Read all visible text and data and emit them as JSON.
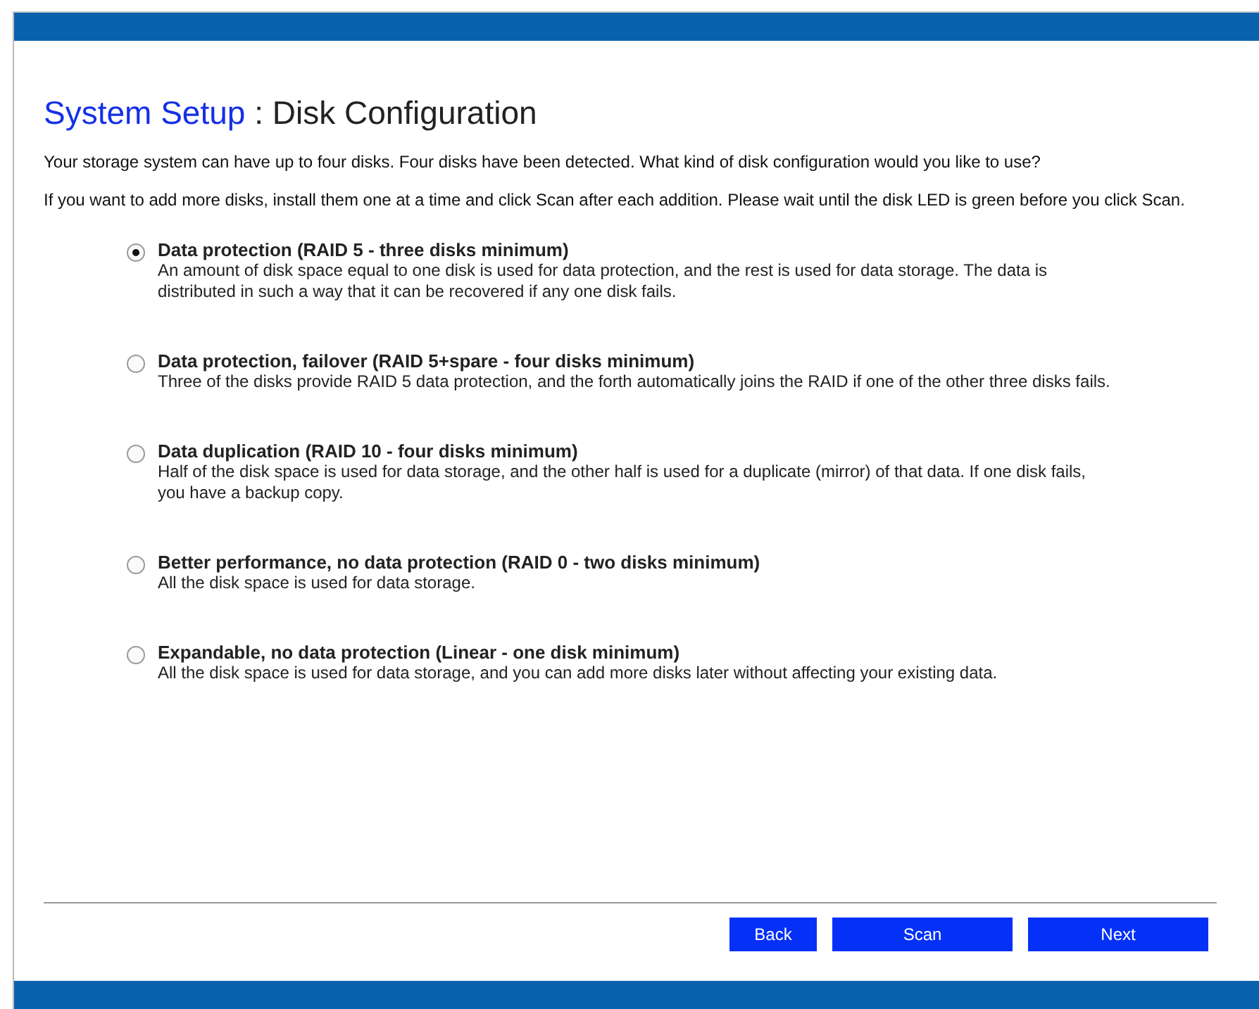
{
  "title": {
    "section": "System Setup",
    "separator": " : ",
    "page": "Disk Configuration"
  },
  "intro": [
    "Your storage system can have up to four disks. Four disks have been detected. What kind of disk configuration would you like to use?",
    "If you want to add more disks, install them one at a time and click Scan after each addition. Please wait until the disk LED is green before you click Scan."
  ],
  "options": [
    {
      "label": "Data protection (RAID 5 - three disks minimum)",
      "description": "An amount of disk space equal to one disk is used for data protection, and the rest is used for data storage. The data is distributed in such a way that it can be recovered if any one disk fails.",
      "selected": true
    },
    {
      "label": "Data protection, failover (RAID 5+spare - four disks minimum)",
      "description": "Three of the disks provide RAID 5 data protection, and the forth automatically joins the RAID if one of the other three disks fails.",
      "selected": false
    },
    {
      "label": "Data duplication (RAID 10 - four disks minimum)",
      "description": "Half of the disk space is used for data storage, and the other half is used for a duplicate (mirror) of that data. If one disk fails, you have a backup copy.",
      "selected": false
    },
    {
      "label": "Better performance, no data protection (RAID 0 - two disks minimum)",
      "description": "All the disk space is used for data storage.",
      "selected": false
    },
    {
      "label": "Expandable, no data protection (Linear - one disk minimum)",
      "description": "All the disk space is used for data storage, and you can add more disks later without affecting your existing data.",
      "selected": false
    }
  ],
  "buttons": [
    {
      "label": "Back",
      "kind": "small"
    },
    {
      "label": "Scan",
      "kind": "wide"
    },
    {
      "label": "Next",
      "kind": "wide"
    }
  ]
}
